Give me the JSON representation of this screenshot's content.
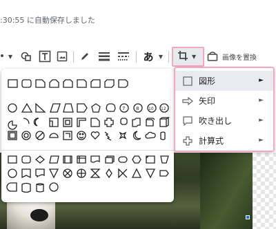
{
  "header": {
    "autosave_text": ":30:55 に自動保存しました"
  },
  "toolbar": {
    "input_tools_glyph": "あ",
    "replace_image_label": "画像を置換"
  },
  "shape_menu": {
    "items": [
      {
        "label": "図形",
        "icon": "square-icon",
        "arrow": "►",
        "active": true
      },
      {
        "label": "矢印",
        "icon": "arrow-icon",
        "arrow": "►",
        "active": false
      },
      {
        "label": "吹き出し",
        "icon": "speech-bubble-icon",
        "arrow": "►",
        "active": false
      },
      {
        "label": "計算式",
        "icon": "plus-icon",
        "arrow": "►",
        "active": false
      }
    ]
  },
  "shape_palette": {
    "groups": [
      "basic-shapes-row-1",
      "basic-shapes-row-2",
      "basic-shapes-row-3",
      "basic-shapes-row-4",
      "flowchart-row-1",
      "flowchart-row-2",
      "flowchart-row-3"
    ]
  },
  "colors": {
    "highlight_border": "#f4a7c2",
    "active_menu_bg": "#e9eaed",
    "selection_handle": "#1a73e8"
  }
}
